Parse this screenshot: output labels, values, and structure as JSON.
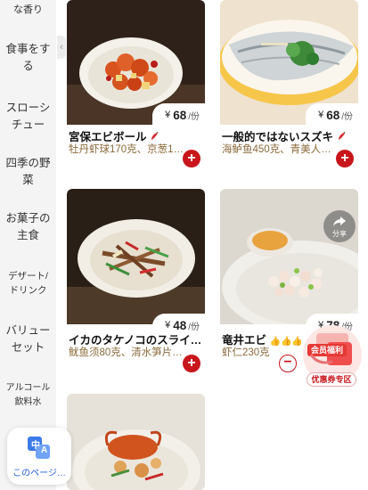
{
  "sidebar": {
    "items": [
      {
        "label": "な香り"
      },
      {
        "label": "食事をする"
      },
      {
        "label": "スローシチュー"
      },
      {
        "label": "四季の野菜"
      },
      {
        "label": "お菓子の主食"
      },
      {
        "label": "デザート/ドリンク"
      },
      {
        "label": "バリューセット"
      },
      {
        "label": "アルコール飲料水"
      }
    ]
  },
  "products": [
    {
      "name": "宮保エビボール",
      "desc": "牡丹虾球170克、京葱10…",
      "yen": "¥",
      "price": "68",
      "unit": "/份",
      "spicy": true
    },
    {
      "name": "一般的ではないスズキ",
      "desc": "海鲈鱼450克、青美人椒…",
      "yen": "¥",
      "price": "68",
      "unit": "/份",
      "spicy": true
    },
    {
      "name": "イカのタケノコのスライ…",
      "desc": "鱿鱼须80克、清水笋片…",
      "yen": "¥",
      "price": "48",
      "unit": "/份",
      "spicy": false
    },
    {
      "name": "竜井エビ",
      "desc": "虾仁230克",
      "yen": "¥",
      "price": "78",
      "unit": "/份",
      "spicy": false,
      "thumbs": "👍👍👍"
    }
  ],
  "share": {
    "label": "分享"
  },
  "coupon": {
    "title": "会员福利",
    "zone": "优惠券专区"
  },
  "translate": {
    "label": "このページ…",
    "badge_top": "中",
    "badge_bottom": "A"
  },
  "colors": {
    "accent": "#c8161d",
    "desc": "#8a6a3a",
    "translate": "#1e5bd6"
  }
}
